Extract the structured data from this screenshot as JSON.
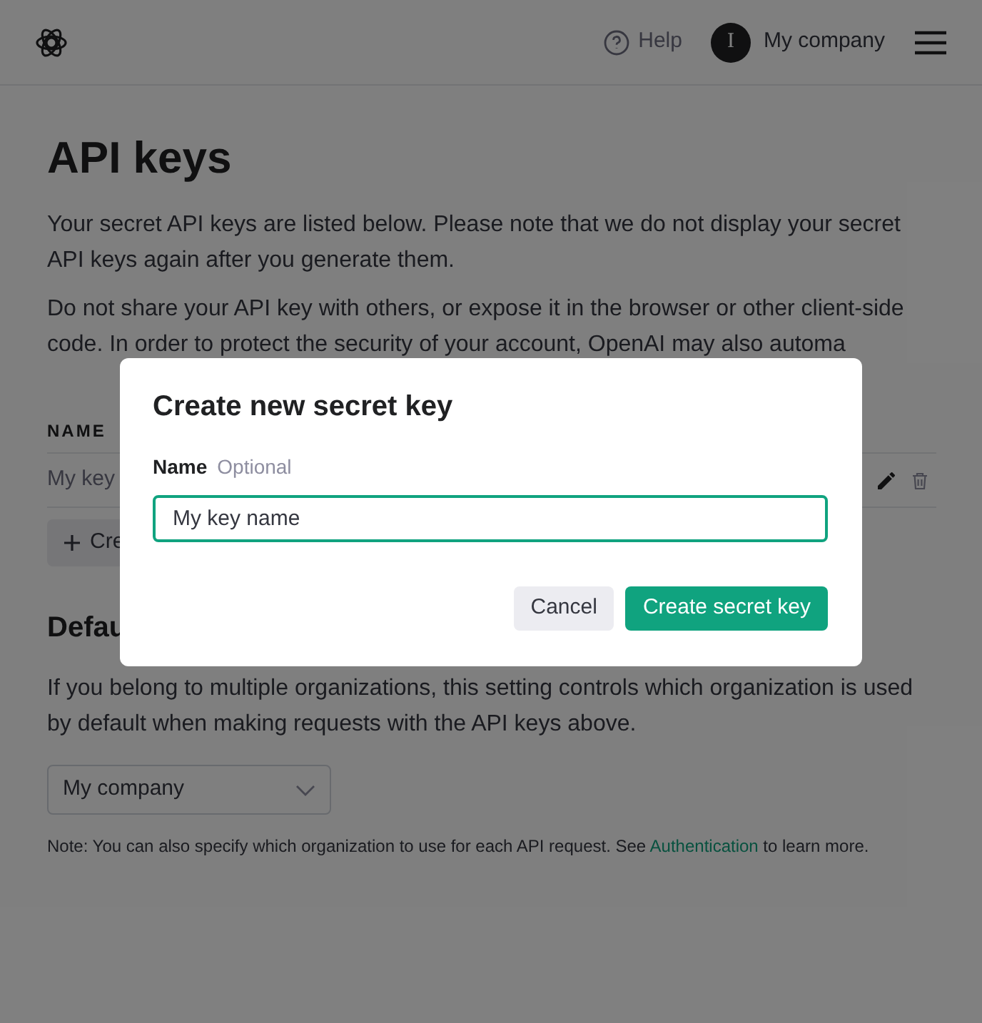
{
  "header": {
    "help": "Help",
    "avatar_initial": "I",
    "org": "My company"
  },
  "page": {
    "title": "API keys",
    "paragraphs": [
      "Your secret API keys are listed below. Please note that we do not display your secret API keys again after you generate them.",
      "Do not share your API key with others, or expose it in the browser or other client-side code. In order to protect the security of your account, OpenAI may also automa"
    ],
    "table": {
      "columns": [
        "NAME"
      ],
      "rows": [
        {
          "name": "My key"
        }
      ]
    },
    "create_button": "Cre",
    "section_title": "Defau",
    "section_text": "If you belong to multiple organizations, this setting controls which organization is used by default when making requests with the API keys above.",
    "org_select": "My company",
    "note": {
      "text": "Note: You can also specify which organization to use for each API request. See",
      "link": "Authentication",
      "after": "to learn more."
    }
  },
  "modal": {
    "title": "Create new secret key",
    "label": "Name",
    "hint": "Optional",
    "value": "My key name",
    "buttons": [
      {
        "label": "Cancel",
        "kind": "secondary"
      },
      {
        "label": "Create secret key",
        "kind": "primary"
      }
    ]
  }
}
